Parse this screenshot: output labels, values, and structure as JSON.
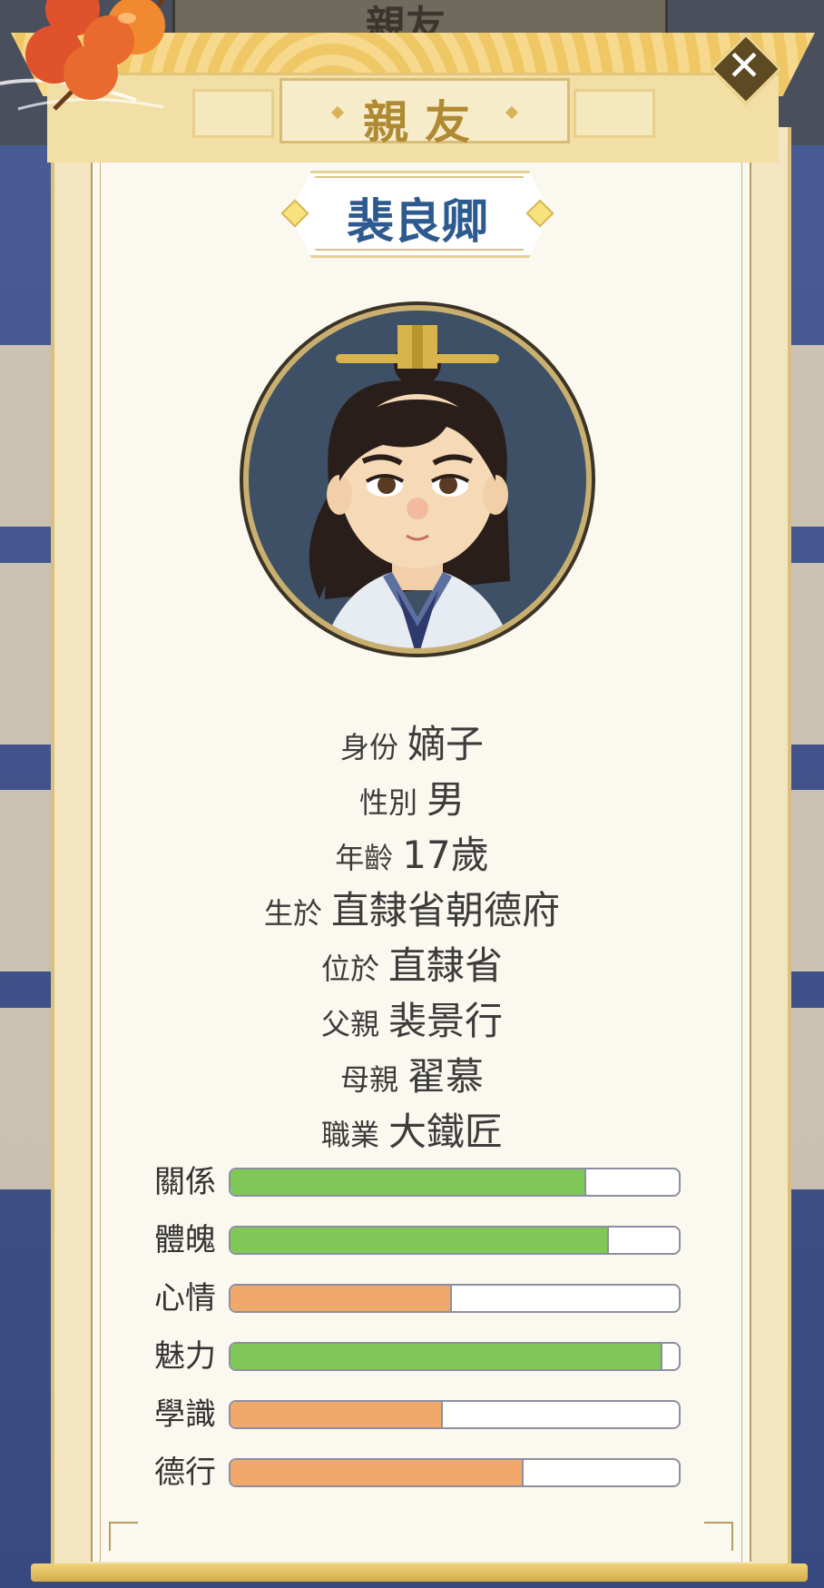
{
  "header": {
    "title": "親友",
    "background_title": "親友"
  },
  "close_icon": "close-x-icon",
  "character": {
    "name": "裴良卿",
    "portrait": "character-portrait"
  },
  "info": [
    {
      "label": "身份",
      "value": "嫡子"
    },
    {
      "label": "性別",
      "value": "男"
    },
    {
      "label": "年齡",
      "value": "17歲"
    },
    {
      "label": "生於",
      "value": "直隸省朝德府"
    },
    {
      "label": "位於",
      "value": "直隸省"
    },
    {
      "label": "父親",
      "value": "裴景行"
    },
    {
      "label": "母親",
      "value": "翟慕"
    },
    {
      "label": "職業",
      "value": "大鐵匠"
    }
  ],
  "stats": [
    {
      "label": "關係",
      "fraction": 0.79,
      "color": "#7fc858"
    },
    {
      "label": "體魄",
      "fraction": 0.84,
      "color": "#7fc858"
    },
    {
      "label": "心情",
      "fraction": 0.49,
      "color": "#f0a96a"
    },
    {
      "label": "魅力",
      "fraction": 0.96,
      "color": "#7fc858"
    },
    {
      "label": "學識",
      "fraction": 0.47,
      "color": "#f0a96a"
    },
    {
      "label": "德行",
      "fraction": 0.65,
      "color": "#f0a96a"
    }
  ]
}
